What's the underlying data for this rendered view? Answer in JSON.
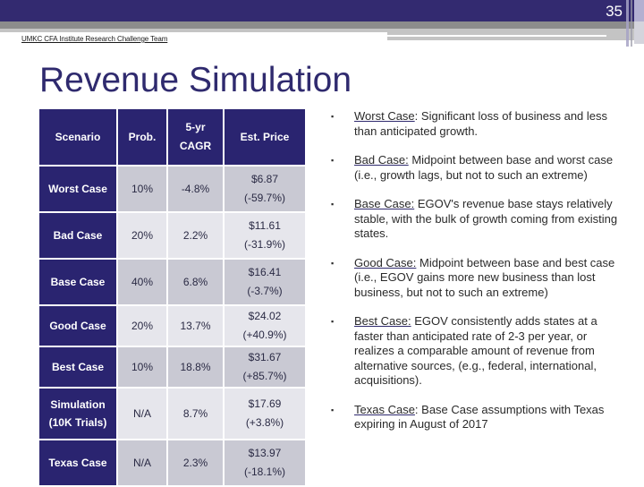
{
  "header": {
    "page_number": "35",
    "team_label": "UMKC CFA Institute Research Challenge Team",
    "title": "Revenue Simulation"
  },
  "colors": {
    "brand_navy": "#2a2470",
    "row_dark": "#c9c9d3",
    "row_light": "#e6e6ec"
  },
  "table": {
    "headers": [
      "Scenario",
      "Prob.",
      "5-yr",
      "CAGR",
      "Est. Price"
    ],
    "rows": [
      {
        "scenario": "Worst Case",
        "scenario2": "",
        "prob": "10%",
        "cagr": "-4.8%",
        "price": "$6.87",
        "change": "(-59.7%)"
      },
      {
        "scenario": "Bad Case",
        "scenario2": "",
        "prob": "20%",
        "cagr": "2.2%",
        "price": "$11.61",
        "change": "(-31.9%)"
      },
      {
        "scenario": "Base Case",
        "scenario2": "",
        "prob": "40%",
        "cagr": "6.8%",
        "price": "$16.41",
        "change": "(-3.7%)"
      },
      {
        "scenario": "Good Case",
        "scenario2": "",
        "prob": "20%",
        "cagr": "13.7%",
        "price": "$24.02",
        "change": "(+40.9%)"
      },
      {
        "scenario": "Best Case",
        "scenario2": "",
        "prob": "10%",
        "cagr": "18.8%",
        "price": "$31.67",
        "change": "(+85.7%)"
      },
      {
        "scenario": "Simulation",
        "scenario2": "(10K Trials)",
        "prob": "N/A",
        "cagr": "8.7%",
        "price": "$17.69",
        "change": "(+3.8%)"
      },
      {
        "scenario": "Texas Case",
        "scenario2": "",
        "prob": "N/A",
        "cagr": "2.3%",
        "price": "$13.97",
        "change": "(-18.1%)"
      }
    ]
  },
  "bullets": [
    {
      "term": "Worst Case",
      "sep": ": ",
      "text": "Significant loss of business and less than anticipated growth."
    },
    {
      "term": "Bad Case:",
      "sep": " ",
      "text": "Midpoint between base and worst case (i.e., growth lags, but not to such an extreme)"
    },
    {
      "term": "Base Case:",
      "sep": " ",
      "text": "EGOV's revenue base stays relatively stable, with the bulk of growth coming from existing states."
    },
    {
      "term": "Good Case:",
      "sep": " ",
      "text": "Midpoint between base and best case (i.e., EGOV gains more new business than lost business, but not to such an extreme)"
    },
    {
      "term": "Best Case:",
      "sep": " ",
      "text": "EGOV consistently adds states at a faster than anticipated rate of 2-3 per year, or realizes a comparable amount of revenue from alternative sources, (e.g., federal, international, acquisitions)."
    },
    {
      "term": "Texas Case",
      "sep": ": ",
      "text": "Base Case assumptions with Texas expiring in August of 2017"
    }
  ],
  "bullet_glyph": "▪"
}
